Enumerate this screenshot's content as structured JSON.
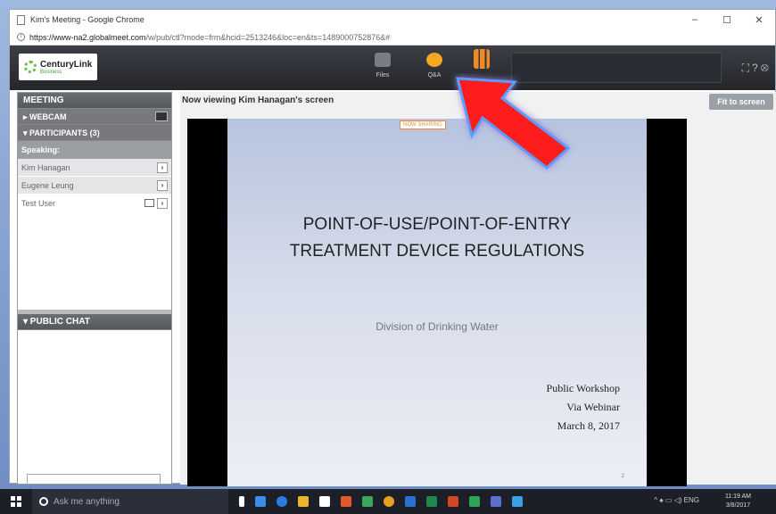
{
  "browser": {
    "title": "Kim's Meeting - Google Chrome",
    "url_host": "https://www-na2.globalmeet.com",
    "url_path": "/w/pub/ctl?mode=frm&hcid=2513246&loc=en&ts=1489000752876&#",
    "controls": [
      "–",
      "☐",
      "✕"
    ]
  },
  "header": {
    "logo_brand": "CenturyLink",
    "logo_sub": "Business",
    "tools": [
      {
        "label": "Files",
        "icon": "files-icon",
        "color": "#7a7d83"
      },
      {
        "label": "Q&A",
        "icon": "qa-icon",
        "color": "#f5a623"
      },
      {
        "label": "",
        "icon": "poll-icon",
        "color": "#f08a24"
      }
    ]
  },
  "sidebar": {
    "meeting": "MEETING",
    "webcam": "▸ WEBCAM",
    "participants": "▾ PARTICIPANTS (3)",
    "speaking": "Speaking:",
    "people": [
      "Kim Hanagan",
      "Eugene Leung",
      "Test User"
    ],
    "public_chat": "▾ PUBLIC CHAT"
  },
  "main": {
    "viewing": "Now viewing Kim Hanagan's screen",
    "fit_button": "Fit to screen"
  },
  "slide": {
    "sharing_badge": "NOW SHARING",
    "title_line1": "POINT-OF-USE/POINT-OF-ENTRY",
    "title_line2": "TREATMENT DEVICE REGULATIONS",
    "division": "Division of Drinking Water",
    "pub1": "Public Workshop",
    "pub2": "Via Webinar",
    "pub3": "March 8, 2017",
    "page": "2"
  },
  "taskbar": {
    "search_placeholder": "Ask me anything",
    "time": "11:19 AM",
    "date": "3/8/2017",
    "lang": "ENG",
    "apps": [
      "#ffffff",
      "#3a8ee6",
      "#e8b62a",
      "#ffffff",
      "#e05a2b",
      "#3aa85a",
      "#e8a020",
      "#2b6fd0",
      "#1f8a4c",
      "#d24726",
      "#2fa35a",
      "#5a6fd0",
      "#3aa0e8"
    ]
  },
  "colors": {
    "accent_red": "#ff0000",
    "header_bg": "#2c2f34"
  }
}
